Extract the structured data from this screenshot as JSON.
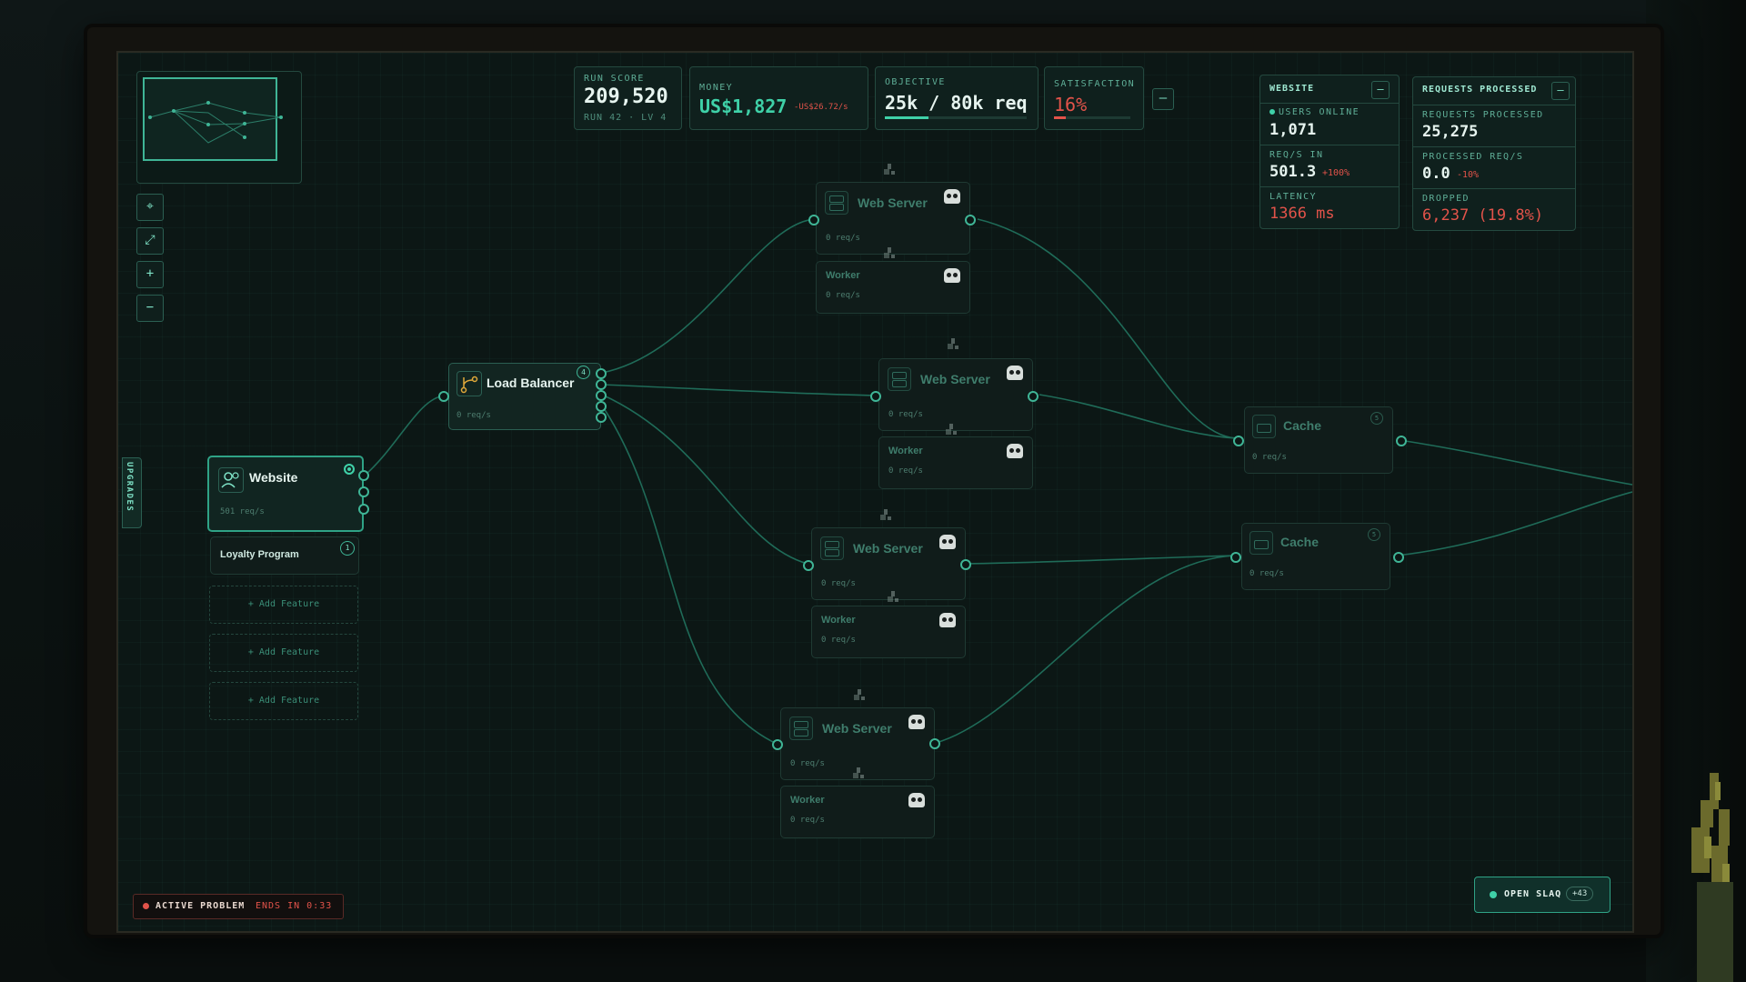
{
  "hud": {
    "run_score": {
      "label": "RUN SCORE",
      "value": "209,520",
      "sub": "RUN 42 · LV 4"
    },
    "money": {
      "label": "MONEY",
      "value": "US$1,827",
      "rate": "-US$26.72/s"
    },
    "objective": {
      "label": "OBJECTIVE",
      "value": "25k / 80k req",
      "progress": 0.31
    },
    "satisfaction": {
      "label": "SATISFACTION",
      "value": "16%",
      "progress": 0.16
    },
    "collapse_label": "–"
  },
  "website_panel": {
    "title": "WEBSITE",
    "collapse_label": "–",
    "users_online_label": "USERS ONLINE",
    "users_online": "1,071",
    "reqs_in_label": "REQ/S IN",
    "reqs_in": "501.3",
    "reqs_in_delta": "+100%",
    "latency_label": "LATENCY",
    "latency": "1366 ms"
  },
  "requests_panel": {
    "title": "REQUESTS PROCESSED",
    "collapse_label": "–",
    "processed_label": "REQUESTS PROCESSED",
    "processed": "25,275",
    "processed_rate_label": "PROCESSED REQ/S",
    "processed_rate": "0.0",
    "processed_rate_delta": "-10%",
    "dropped_label": "DROPPED",
    "dropped": "6,237 (19.8%)"
  },
  "toolbar": {
    "buttons": [
      "⌖",
      "⤢",
      "+",
      "−"
    ],
    "upgrades_tab": "UPGRADES"
  },
  "nodes": {
    "website": {
      "title": "Website",
      "rate": "501 req/s"
    },
    "loyalty": {
      "title": "Loyalty Program",
      "badge": "1"
    },
    "add_feature": "+ Add Feature",
    "load_balancer": {
      "title": "Load Balancer",
      "rate": "0 req/s",
      "badge": "4"
    },
    "web_servers": [
      {
        "title": "Web Server",
        "rate": "0 req/s",
        "worker": "Worker",
        "worker_rate": "0 req/s"
      },
      {
        "title": "Web Server",
        "rate": "0 req/s",
        "worker": "Worker",
        "worker_rate": "0 req/s"
      },
      {
        "title": "Web Server",
        "rate": "0 req/s",
        "worker": "Worker",
        "worker_rate": "0 req/s"
      },
      {
        "title": "Web Server",
        "rate": "0 req/s",
        "worker": "Worker",
        "worker_rate": "0 req/s"
      }
    ],
    "caches": [
      {
        "title": "Cache",
        "rate": "0 req/s",
        "badge": "5"
      },
      {
        "title": "Cache",
        "rate": "0 req/s",
        "badge": "5"
      }
    ]
  },
  "footer": {
    "active_problem_label": "ACTIVE PROBLEM",
    "ends_in": "ENDS IN 0:33",
    "slaq_label": "OPEN SLAQ",
    "slaq_count": "+43"
  },
  "colors": {
    "accent": "#3fd1a8",
    "danger": "#e2534a",
    "gold": "#e0a83a"
  }
}
